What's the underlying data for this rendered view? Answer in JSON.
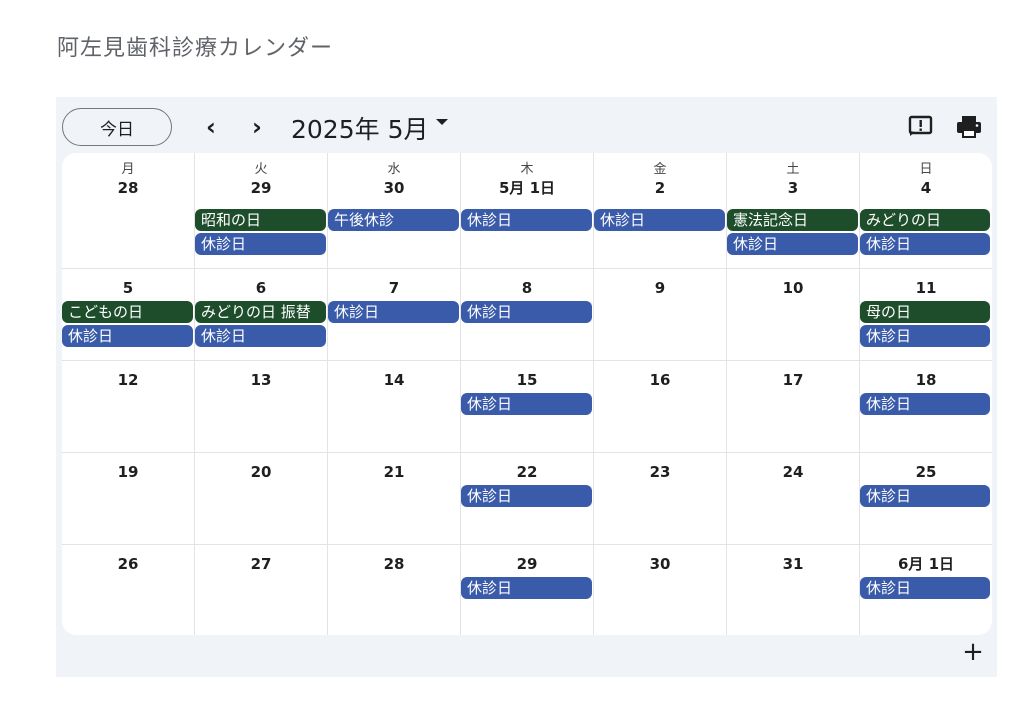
{
  "page_title": "阿左見歯科診療カレンダー",
  "toolbar": {
    "today_label": "今日",
    "prev_icon": "chevron-left-icon",
    "next_icon": "chevron-right-icon",
    "prev_label": "‹",
    "next_label": "›",
    "month_label": "2025年 5月",
    "feedback_icon": "feedback-icon",
    "print_icon": "print-icon"
  },
  "weekdays": [
    "月",
    "火",
    "水",
    "木",
    "金",
    "土",
    "日"
  ],
  "colors": {
    "holiday": "#1e4d2b",
    "closed": "#3a5ba9",
    "frame": "#f0f4f9"
  },
  "weeks": [
    [
      {
        "day": "28",
        "events": []
      },
      {
        "day": "29",
        "events": [
          {
            "title": "昭和の日",
            "type": "holiday"
          },
          {
            "title": "休診日",
            "type": "closed"
          }
        ]
      },
      {
        "day": "30",
        "events": [
          {
            "title": "午後休診",
            "type": "closed"
          }
        ]
      },
      {
        "day": "5月 1日",
        "events": [
          {
            "title": "休診日",
            "type": "closed"
          }
        ]
      },
      {
        "day": "2",
        "events": [
          {
            "title": "休診日",
            "type": "closed"
          }
        ]
      },
      {
        "day": "3",
        "events": [
          {
            "title": "憲法記念日",
            "type": "holiday"
          },
          {
            "title": "休診日",
            "type": "closed"
          }
        ]
      },
      {
        "day": "4",
        "events": [
          {
            "title": "みどりの日",
            "type": "holiday"
          },
          {
            "title": "休診日",
            "type": "closed"
          }
        ]
      }
    ],
    [
      {
        "day": "5",
        "events": [
          {
            "title": "こどもの日",
            "type": "holiday"
          },
          {
            "title": "休診日",
            "type": "closed"
          }
        ]
      },
      {
        "day": "6",
        "events": [
          {
            "title": "みどりの日 振替",
            "type": "holiday"
          },
          {
            "title": "休診日",
            "type": "closed"
          }
        ]
      },
      {
        "day": "7",
        "events": [
          {
            "title": "休診日",
            "type": "closed"
          }
        ]
      },
      {
        "day": "8",
        "events": [
          {
            "title": "休診日",
            "type": "closed"
          }
        ]
      },
      {
        "day": "9",
        "events": []
      },
      {
        "day": "10",
        "events": []
      },
      {
        "day": "11",
        "events": [
          {
            "title": "母の日",
            "type": "holiday"
          },
          {
            "title": "休診日",
            "type": "closed"
          }
        ]
      }
    ],
    [
      {
        "day": "12",
        "events": []
      },
      {
        "day": "13",
        "events": []
      },
      {
        "day": "14",
        "events": []
      },
      {
        "day": "15",
        "events": [
          {
            "title": "休診日",
            "type": "closed"
          }
        ]
      },
      {
        "day": "16",
        "events": []
      },
      {
        "day": "17",
        "events": []
      },
      {
        "day": "18",
        "events": [
          {
            "title": "休診日",
            "type": "closed"
          }
        ]
      }
    ],
    [
      {
        "day": "19",
        "events": []
      },
      {
        "day": "20",
        "events": []
      },
      {
        "day": "21",
        "events": []
      },
      {
        "day": "22",
        "events": [
          {
            "title": "休診日",
            "type": "closed"
          }
        ]
      },
      {
        "day": "23",
        "events": []
      },
      {
        "day": "24",
        "events": []
      },
      {
        "day": "25",
        "events": [
          {
            "title": "休診日",
            "type": "closed"
          }
        ]
      }
    ],
    [
      {
        "day": "26",
        "events": []
      },
      {
        "day": "27",
        "events": []
      },
      {
        "day": "28",
        "events": []
      },
      {
        "day": "29",
        "events": [
          {
            "title": "休診日",
            "type": "closed"
          }
        ]
      },
      {
        "day": "30",
        "events": []
      },
      {
        "day": "31",
        "events": []
      },
      {
        "day": "6月 1日",
        "events": [
          {
            "title": "休診日",
            "type": "closed"
          }
        ]
      }
    ]
  ],
  "add_label": "+"
}
